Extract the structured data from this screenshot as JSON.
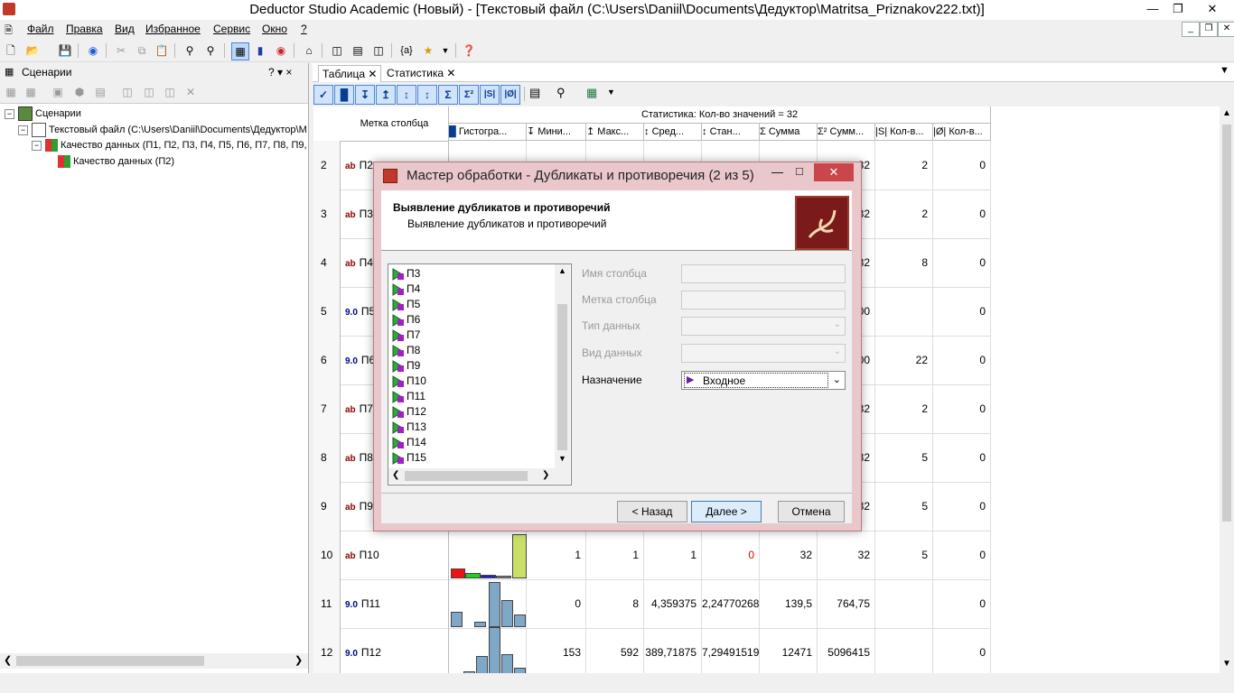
{
  "window": {
    "title": "Deductor Studio Academic (Новый) - [Текстовый файл (C:\\Users\\Daniil\\Documents\\Дедуктор\\Matritsa_Priznakov222.txt)]"
  },
  "menu": [
    "Файл",
    "Правка",
    "Вид",
    "Избранное",
    "Сервис",
    "Окно",
    "?"
  ],
  "left_panel": {
    "title": "Сценарии",
    "header_controls": "? ▾ ×",
    "tree": [
      {
        "label": "Сценарии",
        "level": 0
      },
      {
        "label": "Текстовый файл (C:\\Users\\Daniil\\Documents\\Дедуктор\\M",
        "level": 1
      },
      {
        "label": "Качество данных (П1, П2, П3, П4, П5, П6, П7, П8, П9,",
        "level": 2
      },
      {
        "label": "Качество данных (П2)",
        "level": 3
      }
    ]
  },
  "tabs": [
    {
      "label": "Таблица"
    },
    {
      "label": "Статистика"
    }
  ],
  "grid": {
    "col_header_label": "Метка столбца",
    "stats_header": "Статистика: Кол-во значений = 32",
    "columns": [
      "Гистогра...",
      "Мини...",
      "Макс...",
      "Сред...",
      "Стан...",
      "Сумма",
      "Сумм...",
      "Кол-в...",
      "Кол-в..."
    ],
    "rows": [
      {
        "n": "2",
        "type": "ab",
        "name": "П2",
        "sumsq": "32",
        "uniq": "2",
        "nulls": "0"
      },
      {
        "n": "3",
        "type": "ab",
        "name": "П3",
        "sumsq": "32",
        "uniq": "2",
        "nulls": "0"
      },
      {
        "n": "4",
        "type": "ab",
        "name": "П4",
        "sumsq": "32",
        "uniq": "8",
        "nulls": "0"
      },
      {
        "n": "5",
        "type": "9.0",
        "name": "П5",
        "sumsq": "00",
        "uniq": "",
        "nulls": "0"
      },
      {
        "n": "6",
        "type": "9.0",
        "name": "П6",
        "sumsq": "00",
        "uniq": "22",
        "nulls": "0"
      },
      {
        "n": "7",
        "type": "ab",
        "name": "П7",
        "sumsq": "32",
        "uniq": "2",
        "nulls": "0"
      },
      {
        "n": "8",
        "type": "ab",
        "name": "П8",
        "sumsq": "32",
        "uniq": "5",
        "nulls": "0"
      },
      {
        "n": "9",
        "type": "ab",
        "name": "П9",
        "sumsq": "32",
        "uniq": "5",
        "nulls": "0"
      },
      {
        "n": "10",
        "type": "ab",
        "name": "П10",
        "min": "1",
        "max": "1",
        "avg": "1",
        "std": "0",
        "sum": "32",
        "sumsq": "32",
        "uniq": "5",
        "nulls": "0"
      },
      {
        "n": "11",
        "type": "9.0",
        "name": "П11",
        "min": "0",
        "max": "8",
        "avg": "4,359375",
        "std": "2,24770268",
        "sum": "139,5",
        "sumsq": "764,75",
        "uniq": "",
        "nulls": "0"
      },
      {
        "n": "12",
        "type": "9.0",
        "name": "П12",
        "min": "153",
        "max": "592",
        "avg": "389,71875",
        "std": "7,29491519",
        "sum": "12471",
        "sumsq": "5096415",
        "uniq": "",
        "nulls": "0"
      }
    ]
  },
  "dialog": {
    "title": "Мастер обработки - Дубликаты и противоречия (2 из 5)",
    "heading": "Выявление дубликатов и противоречий",
    "subheading": "Выявление дубликатов и противоречий",
    "list": [
      "П3",
      "П4",
      "П5",
      "П6",
      "П7",
      "П8",
      "П9",
      "П10",
      "П11",
      "П12",
      "П13",
      "П14",
      "П15"
    ],
    "fields": {
      "col_name_label": "Имя столбца",
      "col_label_label": "Метка столбца",
      "data_type_label": "Тип данных",
      "data_kind_label": "Вид данных",
      "purpose_label": "Назначение",
      "purpose_value": "Входное"
    },
    "buttons": {
      "back": "< Назад",
      "next": "Далее >",
      "cancel": "Отмена"
    }
  },
  "colors": {
    "accent": "#4b86d6",
    "dialog_frame": "#e9c7cb",
    "close_red": "#c9474b"
  }
}
